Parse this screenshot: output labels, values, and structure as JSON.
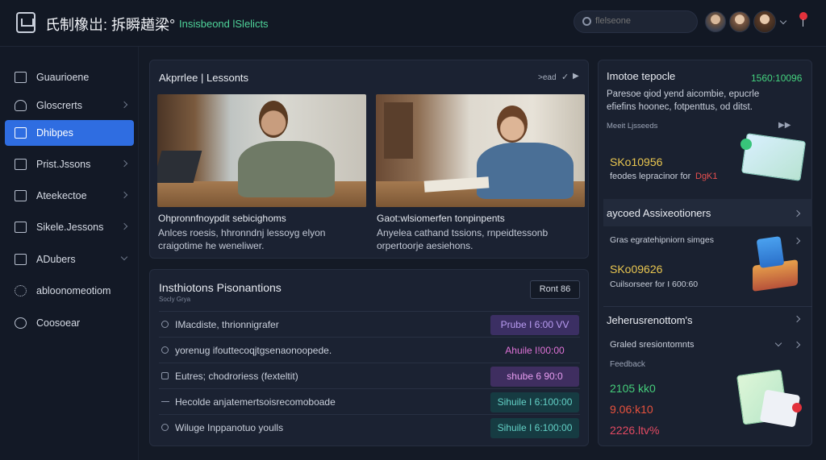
{
  "header": {
    "title": "氏制橡岀: 拆瞬趥梁°",
    "subtitle": "Insisbeond lSlelicts",
    "search_placeholder": "flelseone"
  },
  "sidebar": {
    "items": [
      {
        "label": "Guaurioene",
        "icon": "book-icon",
        "active": false
      },
      {
        "label": "Gloscrerts",
        "icon": "person-icon",
        "active": false
      },
      {
        "label": "Dhibpes",
        "icon": "folder-icon",
        "active": true
      },
      {
        "label": "Prist.Jssons",
        "icon": "document-icon",
        "active": false
      },
      {
        "label": "Ateekectoe",
        "icon": "image-icon",
        "active": false
      },
      {
        "label": "Sikele.Jessons",
        "icon": "chart-icon",
        "active": false
      },
      {
        "label": "ADubers",
        "icon": "grid-icon",
        "active": false
      },
      {
        "label": "abloonomeotiom",
        "icon": "gear-icon",
        "active": false
      },
      {
        "label": "Coosoear",
        "icon": "circle-icon",
        "active": false
      }
    ]
  },
  "lessons": {
    "title": "Akprrlee | Lessonts",
    "more": ">ead",
    "items": [
      {
        "title": "Ohpronnfnoypdit sebicighoms",
        "desc1": "Anlces roesis, hhronndnj lessoyg elyon",
        "desc2": "craigotime he weneliwer."
      },
      {
        "title": "Gaot:wlsiomerfen tonpinpents",
        "desc1": "Anyelea cathand tssions, rnpeidtessonb",
        "desc2": "orpertoorje aesiehons."
      }
    ]
  },
  "instructions": {
    "title": "Insthiotons Pisonantions",
    "subtitle": "Socly Grya",
    "button": "Ront 86",
    "rows": [
      {
        "text": "IMacdiste, thrionnigrafer",
        "pill": "Prube I 6:00 VV",
        "pill_color": "#b99cf2",
        "pill_bg": "#3b2f63",
        "icon": "clock-icon"
      },
      {
        "text": "yorenug ifouttecoqjtgsenaonoopede.",
        "pill": "Ahuile I!00:00",
        "pill_color": "#e073d8",
        "pill_bg": "transparent",
        "icon": "clock-icon"
      },
      {
        "text": "Eutres; chodroriess (fexteltit)",
        "pill": "shube 6 90:0",
        "pill_color": "#e79df0",
        "pill_bg": "#3f2e60",
        "icon": "tag-icon"
      },
      {
        "text": "Hecolde anjatemertsoisrecomoboade",
        "pill": "Sihuile I 6:100:00",
        "pill_color": "#63d1c6",
        "pill_bg": "#163b42",
        "icon": "arrow-icon"
      },
      {
        "text": "Wiluge Inppanotuo youlls",
        "pill": "Sihuile I 6:100:00",
        "pill_color": "#63d1c6",
        "pill_bg": "#163b42",
        "icon": "clock-icon"
      }
    ]
  },
  "right": {
    "top": {
      "title": "Imotoe tepocle",
      "value": "1560:10096",
      "value_color": "#44d27e",
      "desc1": "Paresoe qiod yend aicombie, epucrle",
      "desc2": "efiefins hoonec, fotpenttus, od ditst.",
      "meta": "Meeit Ljsseeds",
      "stat": "SKo10956",
      "stat_color": "#e9c650",
      "note": "feodes lepracinor for",
      "note_accent": "DgK1",
      "note_accent_color": "#e84f4f"
    },
    "assessments": {
      "title": "aycoed Assixeotioners",
      "row": "Gras egratehipniorn simges",
      "stat": "SKo09626",
      "stat_color": "#e9c650",
      "note": "Cuilsorseer for I 600:60"
    },
    "jeherus": {
      "title": "Jeherusrenottom's",
      "row": "Graled sresiontomnts",
      "feedback": "Feedback",
      "values": [
        {
          "text": "2105 kk0",
          "color": "#45cd7a"
        },
        {
          "text": "9.06:k10",
          "color": "#e8523d"
        },
        {
          "text": "2226.ltv%",
          "color": "#e34a62"
        }
      ]
    }
  }
}
